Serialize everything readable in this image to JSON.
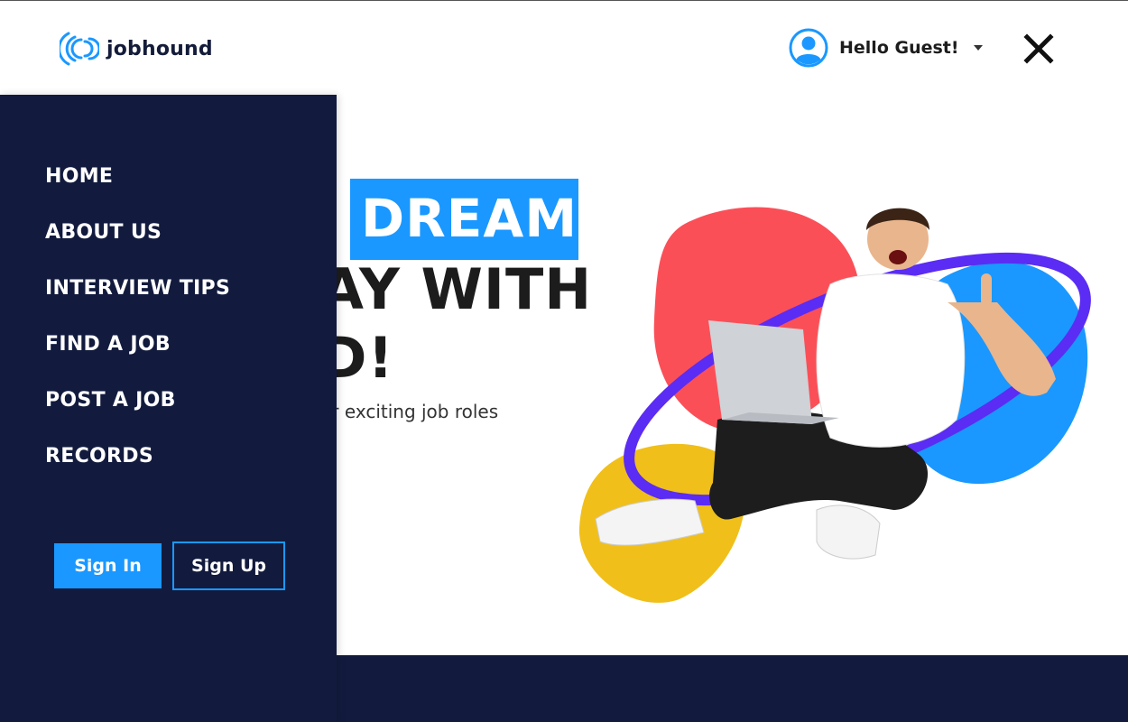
{
  "header": {
    "brand": "jobhound",
    "greeting": "Hello Guest!",
    "icons": {
      "logo": "waves-logo-icon",
      "avatar": "user-avatar-icon",
      "caret": "caret-down-icon",
      "close": "close-icon"
    }
  },
  "hero": {
    "highlight": "DREAM",
    "line2": "AY WITH",
    "line3": "D!",
    "subtitle": "er exciting job roles"
  },
  "sidebar": {
    "items": [
      {
        "label": "HOME"
      },
      {
        "label": "ABOUT US"
      },
      {
        "label": "INTERVIEW TIPS"
      },
      {
        "label": "FIND A JOB"
      },
      {
        "label": "POST A JOB"
      },
      {
        "label": "RECORDS"
      }
    ],
    "sign_in": "Sign In",
    "sign_up": "Sign Up"
  },
  "colors": {
    "navy": "#121b3d",
    "accent_blue": "#1a98ff",
    "blob_red": "#fb4f58",
    "blob_yellow": "#f0bf1a",
    "ring_purple": "#5b2cf3"
  }
}
